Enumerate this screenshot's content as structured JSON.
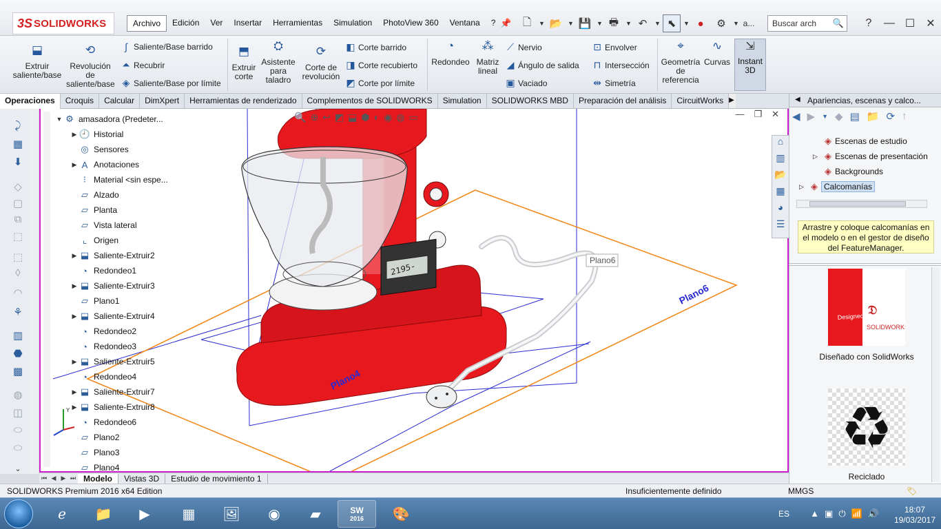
{
  "app": {
    "logo_text": "SOLIDWORKS",
    "logo_mark": "3S"
  },
  "menu": [
    {
      "label": "Archivo",
      "active": true
    },
    {
      "label": "Edición"
    },
    {
      "label": "Ver"
    },
    {
      "label": "Insertar"
    },
    {
      "label": "Herramientas"
    },
    {
      "label": "Simulation"
    },
    {
      "label": "PhotoView 360"
    },
    {
      "label": "Ventana"
    },
    {
      "label": "?"
    }
  ],
  "quick_access": {
    "extra_label": "a...",
    "search_placeholder": "Buscar arch"
  },
  "ribbon": {
    "extruir": "Extruir saliente/base",
    "revolucion": "Revolución de saliente/base",
    "barrido": "Saliente/Base barrido",
    "recubrir": "Recubrir",
    "limite": "Saliente/Base por límite",
    "extruir_corte": "Extruir corte",
    "asistente": "Asistente para taladro",
    "corte_revolucion": "Corte de revolución",
    "corte_barrido": "Corte barrido",
    "corte_recubierto": "Corte recubierto",
    "corte_limite": "Corte por límite",
    "redondeo": "Redondeo",
    "matriz": "Matriz lineal",
    "nervio": "Nervio",
    "angulo": "Ángulo de salida",
    "vaciado": "Vaciado",
    "envolver": "Envolver",
    "interseccion": "Intersección",
    "simetria": "Simetría",
    "geometria": "Geometría de referencia",
    "curvas": "Curvas",
    "instant3d": "Instant 3D"
  },
  "tabs": [
    "Operaciones",
    "Croquis",
    "Calcular",
    "DimXpert",
    "Herramientas de renderizado",
    "Complementos de SOLIDWORKS",
    "Simulation",
    "SOLIDWORKS MBD",
    "Preparación del análisis",
    "CircuitWorks"
  ],
  "feature_tree": {
    "root": "amasadora  (Predeter...",
    "items": [
      {
        "label": "Historial",
        "icon": "history-folder-icon",
        "expand": true
      },
      {
        "label": "Sensores",
        "icon": "sensor-icon",
        "expand": false
      },
      {
        "label": "Anotaciones",
        "icon": "annotation-icon",
        "expand": true
      },
      {
        "label": "Material <sin espe...",
        "icon": "material-icon",
        "expand": false
      },
      {
        "label": "Alzado",
        "icon": "plane-icon",
        "expand": false
      },
      {
        "label": "Planta",
        "icon": "plane-icon",
        "expand": false
      },
      {
        "label": "Vista lateral",
        "icon": "plane-icon",
        "expand": false
      },
      {
        "label": "Origen",
        "icon": "origin-icon",
        "expand": false
      },
      {
        "label": "Saliente-Extruir2",
        "icon": "extrude-icon",
        "expand": true
      },
      {
        "label": "Redondeo1",
        "icon": "fillet-icon",
        "expand": false
      },
      {
        "label": "Saliente-Extruir3",
        "icon": "extrude-icon",
        "expand": true
      },
      {
        "label": "Plano1",
        "icon": "plane-icon",
        "expand": false
      },
      {
        "label": "Saliente-Extruir4",
        "icon": "extrude-icon",
        "expand": true
      },
      {
        "label": "Redondeo2",
        "icon": "fillet-icon",
        "expand": false
      },
      {
        "label": "Redondeo3",
        "icon": "fillet-icon",
        "expand": false
      },
      {
        "label": "Saliente-Extruir5",
        "icon": "extrude-icon",
        "expand": true
      },
      {
        "label": "Redondeo4",
        "icon": "fillet-icon",
        "expand": false
      },
      {
        "label": "Saliente-Extruir7",
        "icon": "extrude-icon",
        "expand": true
      },
      {
        "label": "Saliente-Extruir8",
        "icon": "extrude-icon",
        "expand": true
      },
      {
        "label": "Redondeo6",
        "icon": "fillet-icon",
        "expand": false
      },
      {
        "label": "Plano2",
        "icon": "plane-icon",
        "expand": false
      },
      {
        "label": "Plano3",
        "icon": "plane-icon",
        "expand": false
      },
      {
        "label": "Plano4",
        "icon": "plane-icon",
        "expand": false
      }
    ]
  },
  "viewport": {
    "plane6_label": "Plano6",
    "plane6_tooltip": "Plano6",
    "plane4_label": "Plano4",
    "display_readout": "2195-"
  },
  "bottom_tabs": [
    "Modelo",
    "Vistas 3D",
    "Estudio de movimiento 1"
  ],
  "status": {
    "edition": "SOLIDWORKS Premium 2016 x64 Edition",
    "state": "Insuficientemente definido",
    "units": "MMGS"
  },
  "task_pane": {
    "title": "Apariencias, escenas y calco...",
    "items": [
      {
        "label": "Escenas de estudio",
        "expand": false
      },
      {
        "label": "Escenas de presentación",
        "expand": true
      },
      {
        "label": "Backgrounds",
        "expand": false
      },
      {
        "label": "Calcomanías",
        "expand": true,
        "selected": true
      }
    ],
    "hint": "Arrastre y coloque calcomanías en el modelo o en el gestor de diseño del FeatureManager.",
    "thumb1_caption": "Diseñado con SolidWorks",
    "thumb1_text_a": "Designed with",
    "thumb1_text_b": "SOLIDWORKS",
    "thumb2_caption": "Reciclado"
  },
  "taskbar": {
    "language": "ES",
    "time": "18:07",
    "date": "19/03/2017",
    "sw_badge": "2016"
  },
  "colors": {
    "mixer_red": "#e8181f",
    "plane_orange": "#f08a1c",
    "plane_blue": "#2a2ad0",
    "viewport_border": "#d021d0",
    "hint_bg": "#ffffc4"
  }
}
